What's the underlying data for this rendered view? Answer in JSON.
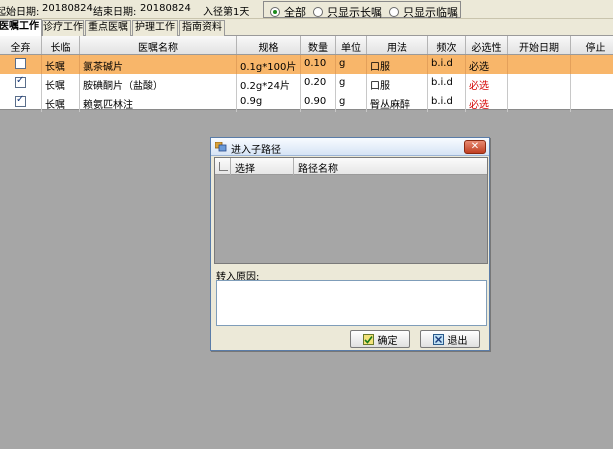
{
  "topbar": {
    "start_label": "起始日期:",
    "start_value": "20180824",
    "end_label": "结束日期:",
    "end_value": "20180824",
    "path_day": "入径第1天",
    "radios": [
      {
        "label": "全部",
        "checked": true
      },
      {
        "label": "只显示长嘱",
        "checked": false
      },
      {
        "label": "只显示临嘱",
        "checked": false
      }
    ]
  },
  "tabs": [
    "医嘱工作",
    "诊疗工作",
    "重点医嘱",
    "护理工作",
    "指南资料"
  ],
  "grid": {
    "columns": [
      "全弃",
      "长临",
      "医嘱名称",
      "规格",
      "数量",
      "单位",
      "用法",
      "频次",
      "必选性",
      "开始日期",
      "停止"
    ],
    "rows": [
      {
        "checked": false,
        "type": "长嘱",
        "name": "氯茶碱片",
        "spec": "0.1g*100片",
        "qty": "0.10",
        "unit": "g",
        "usage": "口服",
        "freq": "b.i.d",
        "required": "必选",
        "start": "",
        "stop": ""
      },
      {
        "checked": true,
        "type": "长嘱",
        "name": "胺碘酮片（盐酸）",
        "spec": "0.2g*24片",
        "qty": "0.20",
        "unit": "g",
        "usage": "口服",
        "freq": "b.i.d",
        "required": "必选",
        "start": "",
        "stop": ""
      },
      {
        "checked": true,
        "type": "长嘱",
        "name": "赖氨匹林注",
        "spec": "0.9g",
        "qty": "0.90",
        "unit": "g",
        "usage": "臀丛麻醉",
        "freq": "b.i.d",
        "required": "必选",
        "start": "",
        "stop": ""
      }
    ]
  },
  "dialog": {
    "title": "进入子路径",
    "close_label": "✕",
    "list_columns": [
      "选择",
      "路径名称"
    ],
    "reason_label": "转入原因:",
    "reason_value": "",
    "ok_label": "确定",
    "exit_label": "退出"
  }
}
